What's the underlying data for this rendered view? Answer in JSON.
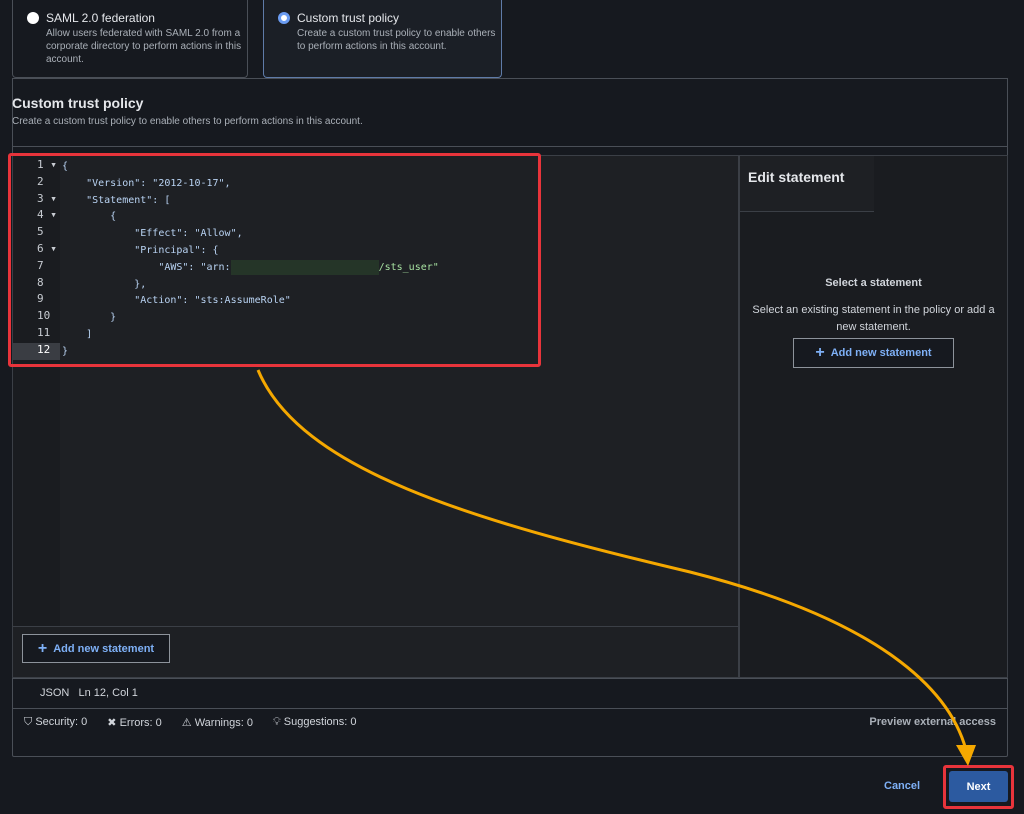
{
  "options": [
    {
      "title": "SAML 2.0 federation",
      "desc": "Allow users federated with SAML 2.0 from a corporate directory to perform actions in this account.",
      "selected": false
    },
    {
      "title": "Custom trust policy",
      "desc": "Create a custom trust policy to enable others to perform actions in this account.",
      "selected": true
    }
  ],
  "section": {
    "title": "Custom trust policy",
    "desc": "Create a custom trust policy to enable others to perform actions in this account."
  },
  "editor": {
    "line_numbers": [
      "1",
      "2",
      "3",
      "4",
      "5",
      "6",
      "7",
      "8",
      "9",
      "10",
      "11",
      "12"
    ],
    "lines": [
      "{",
      "    \"Version\": \"2012-10-17\",",
      "    \"Statement\": [",
      "        {",
      "            \"Effect\": \"Allow\",",
      "            \"Principal\": {",
      "                \"AWS\": \"arn:",
      "            },",
      "            \"Action\": \"sts:AssumeRole\"",
      "        }",
      "    ]",
      "}"
    ],
    "arn_suffix": "/sts_user\"",
    "add_statement": "Add new statement"
  },
  "side": {
    "title": "Edit statement",
    "empty_title": "Select a statement",
    "empty_desc": "Select an existing statement in the policy or add a new statement.",
    "add_statement": "Add new statement"
  },
  "status": {
    "lang": "JSON",
    "pos": "Ln 12, Col 1"
  },
  "issues": {
    "security": "Security: 0",
    "errors": "Errors: 0",
    "warnings": "Warnings: 0",
    "suggestions": "Suggestions: 0",
    "preview": "Preview external access"
  },
  "footer": {
    "cancel": "Cancel",
    "next": "Next"
  },
  "colors": {
    "accent": "#6b9cf2",
    "primary_button": "#2c5aa0",
    "highlight": "#e8343b",
    "arrow": "#f5a800"
  }
}
